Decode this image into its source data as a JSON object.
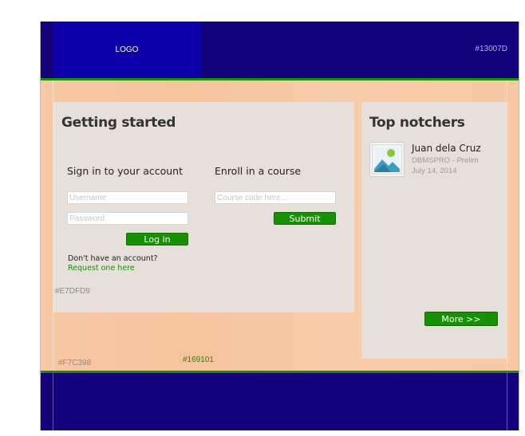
{
  "header": {
    "logo_text": "LOGO",
    "color_label": "#13007D"
  },
  "main_panel": {
    "title": "Getting started",
    "signin": {
      "title": "Sign in to your account",
      "username_placeholder": "Username",
      "password_placeholder": "Password",
      "login_label": "Log in",
      "no_account_text": "Don't have an account?",
      "request_link": "Request one here"
    },
    "enroll": {
      "title": "Enroll in a course",
      "course_placeholder": "Course code here...",
      "submit_label": "Submit"
    },
    "color_label": "#E7DFD9"
  },
  "side_panel": {
    "title": "Top notchers",
    "items": [
      {
        "name": "Juan dela Cruz",
        "course": "DBMSPRO - Prelim",
        "date": "July 14, 2014",
        "icon": "image-placeholder-icon"
      }
    ],
    "more_label": "More >>"
  },
  "content": {
    "color_label": "#F7C398",
    "accent_label": "#169101"
  },
  "colors": {
    "header_bg": "#13007D",
    "panel_bg": "#E7DFD9",
    "content_bg": "#F7C398",
    "accent": "#169101"
  }
}
